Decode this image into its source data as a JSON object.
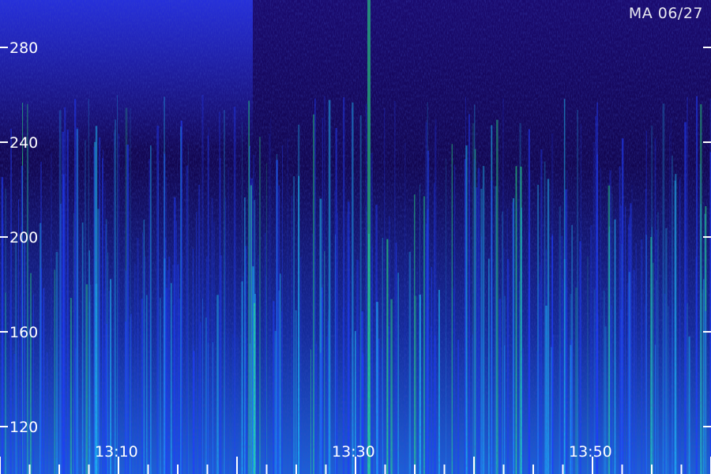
{
  "station_label": "MA 06/27",
  "colors": {
    "background": "#000000",
    "low": "#1a0a6e",
    "mid": "#1e3cff",
    "high": "#1ecfff",
    "peak": "#2bff7a",
    "axis": "#ffffff"
  },
  "chart_data": {
    "type": "heatmap",
    "title": "",
    "xlabel": "",
    "ylabel": "",
    "ylim": [
      100,
      300
    ],
    "xlim": [
      "13:00",
      "14:00"
    ],
    "y_ticks": [
      120,
      160,
      200,
      240,
      280
    ],
    "x_ticks": [
      "13:10",
      "13:30",
      "13:50"
    ],
    "colorscale": [
      "#000000",
      "#1a0a6e",
      "#1e3cff",
      "#1ecfff",
      "#2bff7a"
    ],
    "strong_vertical_events": [
      "13:30"
    ],
    "grid": false,
    "legend": "none"
  }
}
